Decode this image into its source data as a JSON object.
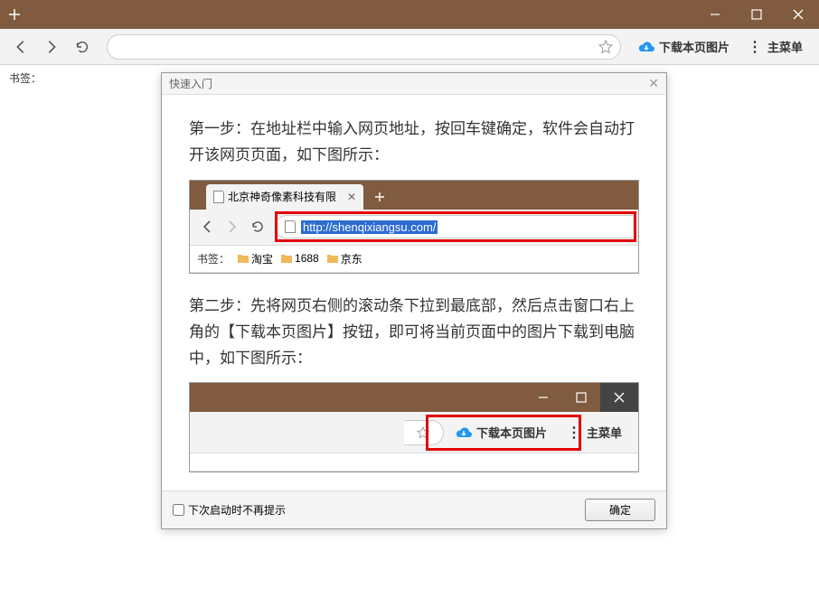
{
  "titlebar": {},
  "toolbar": {
    "download_label": "下载本页图片",
    "menu_label": "主菜单",
    "url_value": ""
  },
  "bookmark_bar": {
    "label": "书签："
  },
  "modal": {
    "title": "快速入门",
    "step1": "第一步：在地址栏中输入网页地址，按回车键确定，软件会自动打开该网页页面，如下图所示：",
    "step2": "第二步：先将网页右侧的滚动条下拉到最底部，然后点击窗口右上角的【下载本页图片】按钮，即可将当前页面中的图片下载到电脑中，如下图所示：",
    "example1": {
      "tab_title": "北京神奇像素科技有限",
      "url": "http://shenqixiangsu.com/",
      "bookmarks_label": "书签：",
      "bookmarks": [
        "淘宝",
        "1688",
        "京东"
      ]
    },
    "example2": {
      "download_label": "下载本页图片",
      "menu_label": "主菜单"
    },
    "footer": {
      "checkbox_label": "下次启动时不再提示",
      "ok_label": "确定"
    }
  }
}
